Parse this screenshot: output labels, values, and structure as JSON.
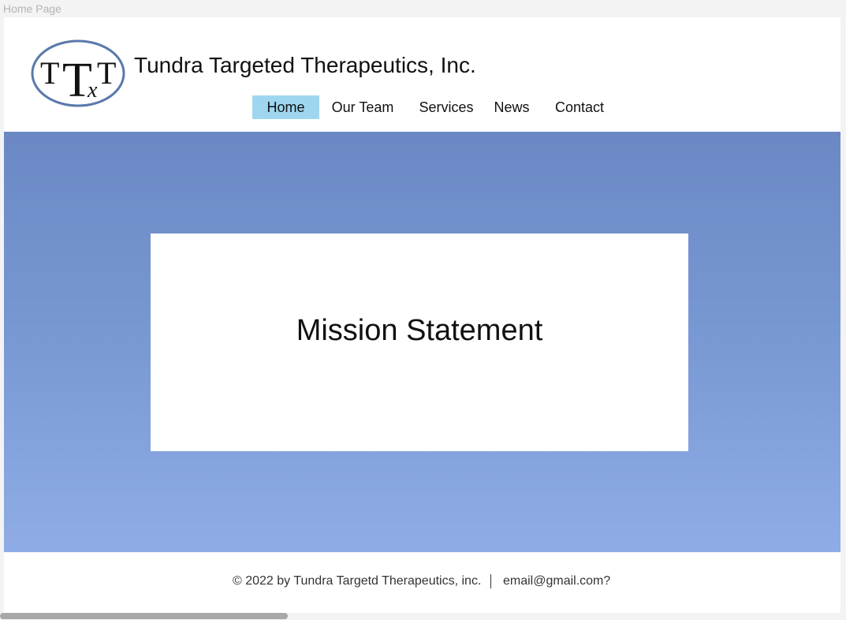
{
  "frame": {
    "label": "Home Page"
  },
  "header": {
    "logo": {
      "letters": [
        "T",
        "T",
        "T",
        "x"
      ]
    },
    "company_name": "Tundra Targeted Therapeutics, Inc.",
    "nav": [
      {
        "label": "Home",
        "active": true
      },
      {
        "label": "Our Team",
        "active": false
      },
      {
        "label": "Services",
        "active": false
      },
      {
        "label": "News",
        "active": false
      },
      {
        "label": "Contact",
        "active": false
      }
    ]
  },
  "hero": {
    "mission_title": "Mission Statement"
  },
  "footer": {
    "copyright": "© 2022 by Tundra Targetd Therapeutics, inc.",
    "email": "email@gmail.com?"
  },
  "colors": {
    "nav_active": "#9fd6ef",
    "hero_top": "#6b88c5",
    "hero_bottom": "#8facE6",
    "logo_ring": "#5a79ab"
  }
}
